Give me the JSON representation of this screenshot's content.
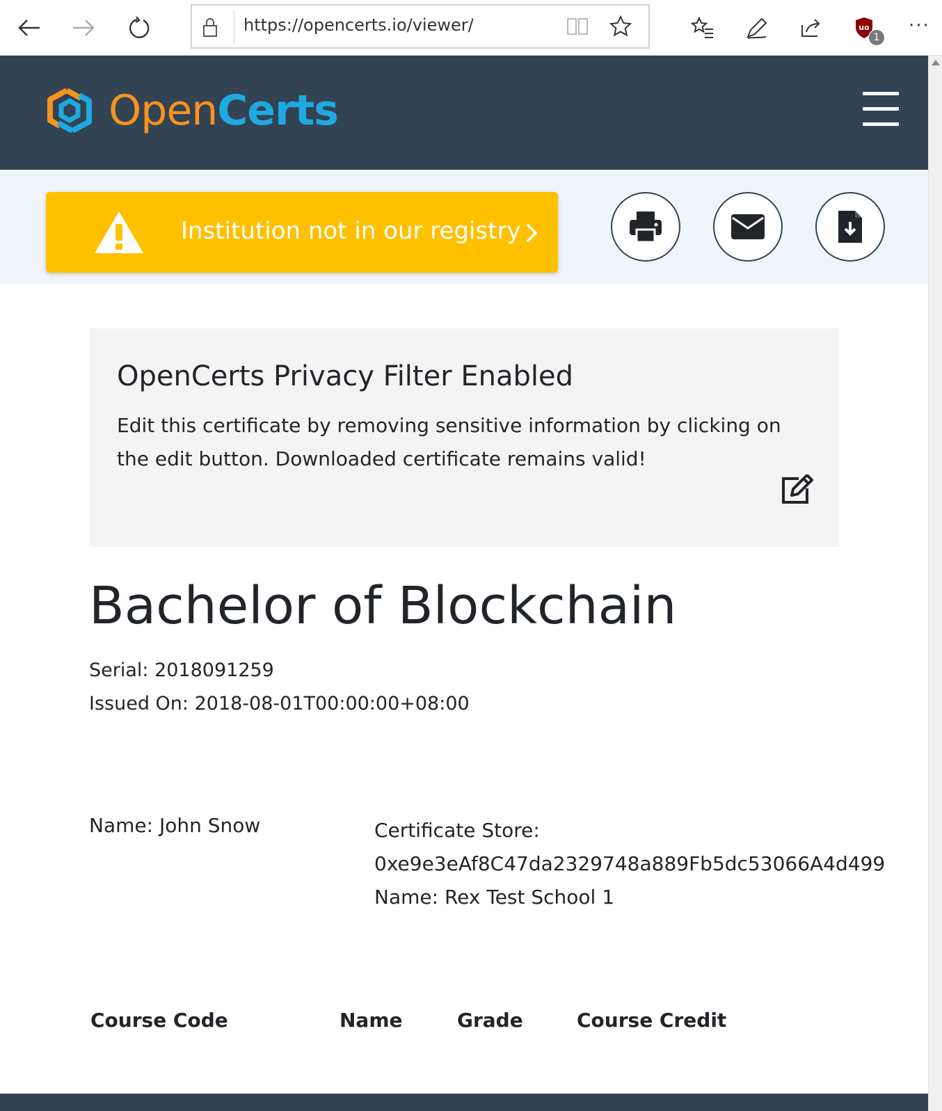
{
  "browser": {
    "url": "https://opencerts.io/viewer/",
    "extension_badge_count": "1",
    "more_label": "···"
  },
  "header": {
    "logo_open": "Open",
    "logo_certs": "Certs"
  },
  "status": {
    "warning_text": "Institution not in our registry",
    "warning_color": "#ffc000"
  },
  "privacy": {
    "title": "OpenCerts Privacy Filter Enabled",
    "description": "Edit this certificate by removing sensitive information by clicking on the edit button. Downloaded certificate remains valid!"
  },
  "certificate": {
    "title": "Bachelor of Blockchain",
    "serial": "Serial: 2018091259",
    "issued_on": "Issued On: 2018-08-01T00:00:00+08:00",
    "recipient_name": "Name: John Snow",
    "store_label": "Certificate Store:",
    "store_address": "0xe9e3eAf8C47da2329748a889Fb5dc53066A4d499",
    "issuer_name": "Name: Rex Test School 1"
  },
  "transcript": {
    "columns": [
      "Course Code",
      "Name",
      "Grade",
      "Course Credit"
    ]
  },
  "colors": {
    "header_bg": "#324353",
    "logo_orange": "#f7931e",
    "logo_blue": "#1fa9e1"
  }
}
